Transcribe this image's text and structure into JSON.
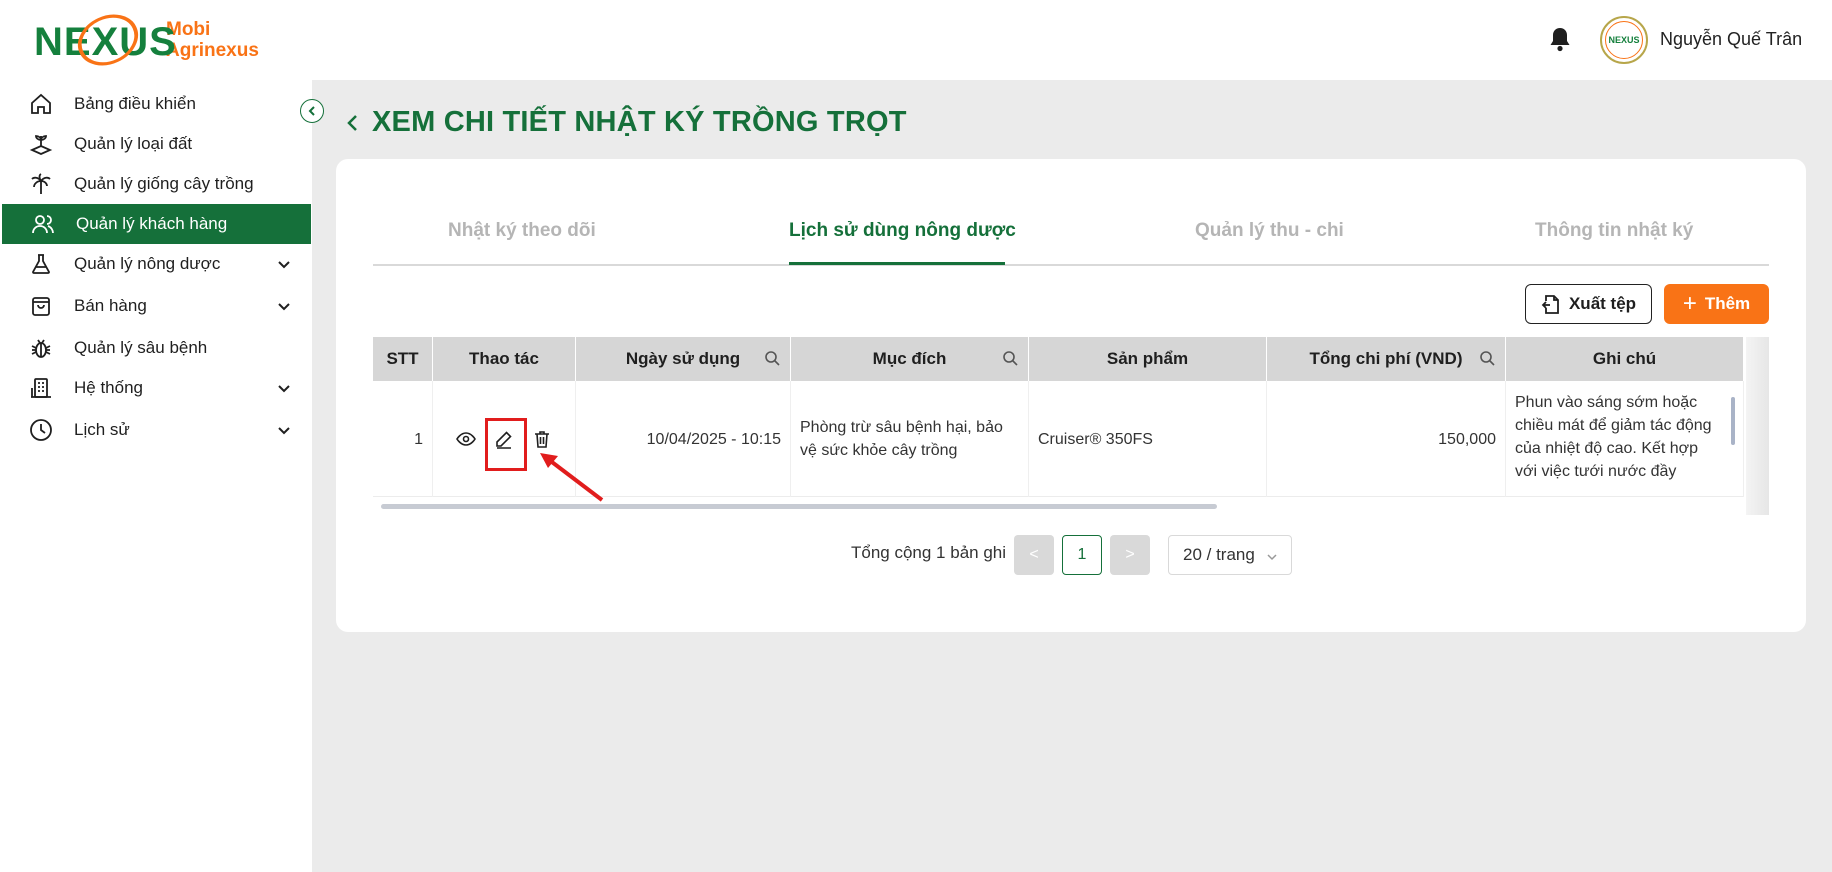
{
  "header": {
    "logo_word": "NEXUS",
    "logo_line1": "Mobi",
    "logo_line2": "Agrinexus",
    "avatar_text": "NEXUS",
    "username": "Nguyễn Quế Trân"
  },
  "sidebar": {
    "items": [
      {
        "label": "Bảng điều khiển",
        "icon": "home-icon"
      },
      {
        "label": "Quản lý loại đất",
        "icon": "soil-icon"
      },
      {
        "label": "Quản lý giống cây trồng",
        "icon": "palm-tree-icon"
      },
      {
        "label": "Quản lý khách hàng",
        "icon": "users-icon"
      },
      {
        "label": "Quản lý nông dược",
        "icon": "flask-icon"
      },
      {
        "label": "Bán hàng",
        "icon": "shopping-bag-icon"
      },
      {
        "label": "Quản lý sâu bệnh",
        "icon": "bug-icon"
      },
      {
        "label": "Hệ thống",
        "icon": "building-icon"
      },
      {
        "label": "Lịch sử",
        "icon": "clock-icon"
      }
    ],
    "active_index": 3
  },
  "page": {
    "title": "XEM CHI TIẾT NHẬT KÝ TRỒNG TRỌT"
  },
  "tabs": [
    {
      "label": "Nhật ký theo dõi"
    },
    {
      "label": "Lịch sử dùng nông dược"
    },
    {
      "label": "Quản lý thu - chi"
    },
    {
      "label": "Thông tin nhật ký"
    }
  ],
  "active_tab": 1,
  "toolbar": {
    "export_label": "Xuất tệp",
    "add_label": "Thêm"
  },
  "table": {
    "columns": [
      "STT",
      "Thao tác",
      "Ngày sử dụng",
      "Mục đích",
      "Sản phẩm",
      "Tổng chi phí (VND)",
      "Ghi chú"
    ],
    "rows": [
      {
        "stt": "1",
        "date": "10/04/2025 - 10:15",
        "purpose": "Phòng trừ sâu bệnh hại, bảo vệ sức khỏe cây trồng",
        "product": "Cruiser® 350FS",
        "cost": "150,000",
        "note": "Phun vào sáng sớm hoặc chiều mát để giảm tác động của nhiệt độ cao. Kết hợp với việc tưới nước đầy"
      }
    ]
  },
  "pagination": {
    "total_text": "Tổng cộng 1 bản ghi",
    "prev": "<",
    "current_page": "1",
    "next": ">",
    "page_size": "20 / trang"
  },
  "colors": {
    "primary_green": "#15703a",
    "accent_orange": "#f97316",
    "highlight_red": "#e11d1d"
  }
}
